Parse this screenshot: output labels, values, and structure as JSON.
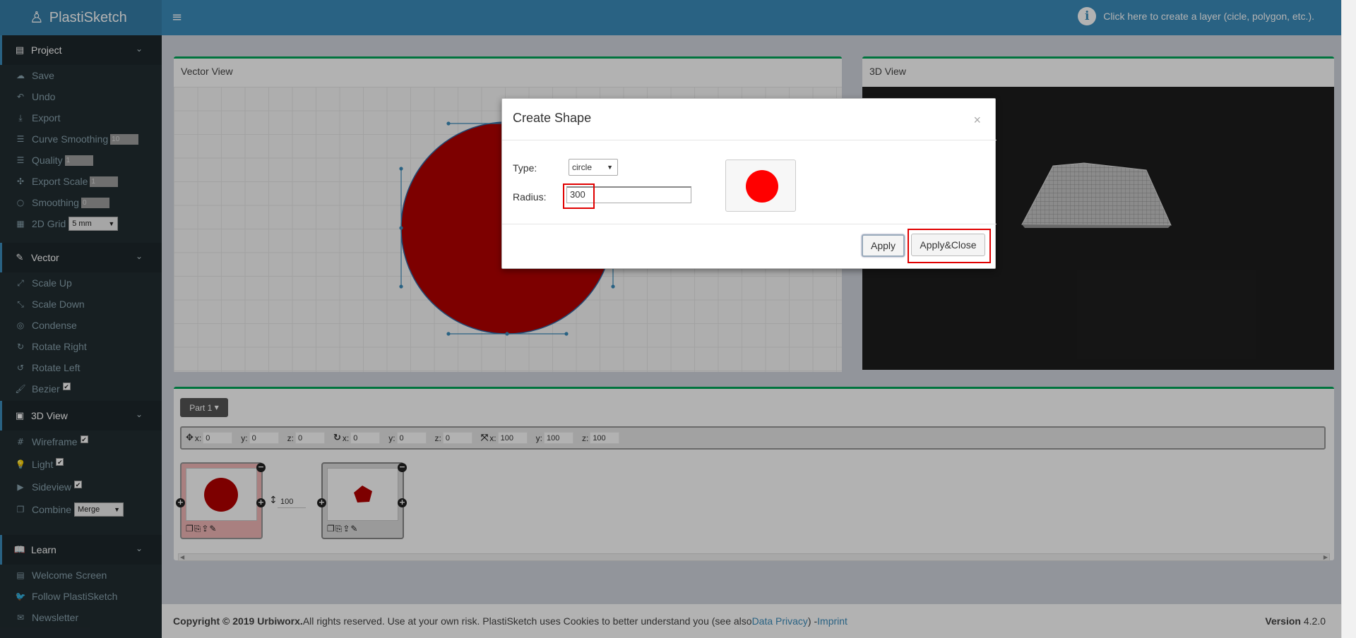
{
  "app": {
    "name": "PlastiSketch",
    "hint": "Click here to create a layer (cicle, polygon, etc.)."
  },
  "sidebar": {
    "project": {
      "title": "Project",
      "save": "Save",
      "undo": "Undo",
      "export": "Export",
      "curve_smoothing": "Curve Smoothing",
      "curve_smoothing_value": "10",
      "quality": "Quality",
      "quality_value": "1",
      "export_scale": "Export Scale",
      "export_scale_value": "1",
      "smoothing": "Smoothing",
      "smoothing_value": "0",
      "grid": "2D Grid",
      "grid_value": "5 mm"
    },
    "vector": {
      "title": "Vector",
      "scale_up": "Scale Up",
      "scale_down": "Scale Down",
      "condense": "Condense",
      "rotate_right": "Rotate Right",
      "rotate_left": "Rotate Left",
      "bezier": "Bezier"
    },
    "view3d": {
      "title": "3D View",
      "wireframe": "Wireframe",
      "light": "Light",
      "sideview": "Sideview",
      "combine": "Combine",
      "combine_value": "Merge"
    },
    "learn": {
      "title": "Learn",
      "welcome": "Welcome Screen",
      "follow": "Follow PlastiSketch",
      "newsletter": "Newsletter"
    }
  },
  "panels": {
    "vector_view": "Vector View",
    "view_3d": "3D View"
  },
  "parts": {
    "button": "Part 1",
    "transform": {
      "x": "x:",
      "x_val": "0",
      "y": "y:",
      "y_val": "0",
      "z": "z:",
      "z_val": "0",
      "rx": "x:",
      "rx_val": "0",
      "ry": "y:",
      "ry_val": "0",
      "rz": "z:",
      "rz_val": "0",
      "sx": "x:",
      "sx_val": "100",
      "sy": "y:",
      "sy_val": "100",
      "sz": "z:",
      "sz_val": "100"
    },
    "layer_height": "100"
  },
  "modal": {
    "title": "Create Shape",
    "close": "×",
    "type_label": "Type:",
    "type_value": "circle",
    "radius_label": "Radius:",
    "radius_value": "300",
    "apply": "Apply",
    "apply_close": "Apply&Close"
  },
  "footer": {
    "copyright": "Copyright © 2019 Urbiworx.",
    "text": " All rights reserved. Use at your own risk. PlastiSketch uses Cookies to better understand you (see also ",
    "privacy": "Data Privacy",
    "sep": ") - ",
    "imprint": "Imprint",
    "version_label": "Version",
    "version": "4.2.0"
  },
  "colors": {
    "brand": "#3c8dbc",
    "shape_red": "#b30000",
    "preview_red": "#ff0000",
    "highlight": "#e00000",
    "box_border": "#00a65a"
  },
  "icons": [
    "joystick-icon",
    "menu-icon",
    "info-icon",
    "file-icon",
    "cloud-upload-icon",
    "undo-icon",
    "download-icon",
    "sliders-icon",
    "expand-icon",
    "circle-icon",
    "grid-icon",
    "pencil-icon",
    "arrows-expand-icon",
    "arrows-compress-icon",
    "target-icon",
    "rotate-right-icon",
    "rotate-left-icon",
    "brush-icon",
    "image-icon",
    "hashtag-icon",
    "lightbulb-icon",
    "video-icon",
    "copy-icon",
    "book-icon",
    "film-icon",
    "twitter-icon",
    "envelope-icon"
  ]
}
